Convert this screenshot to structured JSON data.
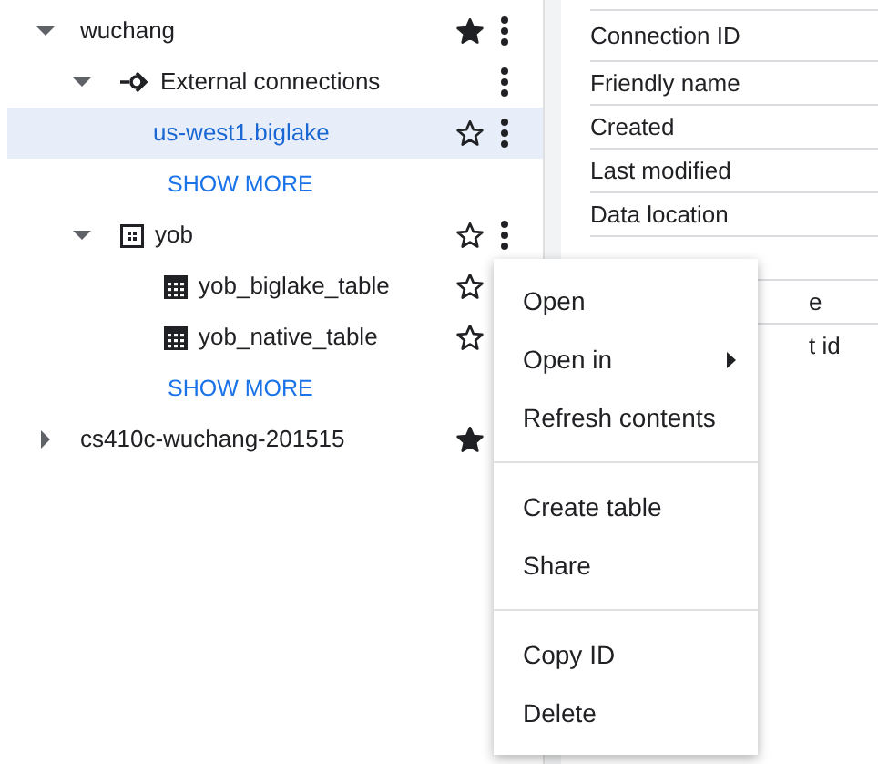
{
  "tree": [
    {
      "kind": "project",
      "label": "wuchang",
      "expanded": true,
      "starred": true,
      "selected": false,
      "children": [
        {
          "kind": "connections",
          "label": "External connections",
          "expanded": true,
          "selected": false,
          "children": [
            {
              "kind": "connection",
              "label": "us-west1.biglake",
              "starred": false,
              "selected": true
            },
            {
              "kind": "more",
              "label": "SHOW MORE"
            }
          ]
        },
        {
          "kind": "dataset",
          "label": "yob",
          "expanded": true,
          "starred": false,
          "selected": false,
          "children": [
            {
              "kind": "table",
              "label": "yob_biglake_table",
              "starred": false,
              "selected": false
            },
            {
              "kind": "table",
              "label": "yob_native_table",
              "starred": false,
              "selected": false
            },
            {
              "kind": "more",
              "label": "SHOW MORE"
            }
          ]
        }
      ]
    },
    {
      "kind": "project",
      "label": "cs410c-wuchang-201515",
      "expanded": false,
      "starred": true,
      "selected": false
    }
  ],
  "details": {
    "rows": [
      "Connection ID",
      "Friendly name",
      "Created",
      "Last modified",
      "Data location",
      "e",
      "t id"
    ]
  },
  "context_menu": {
    "groups": [
      [
        {
          "label": "Open",
          "submenu": false
        },
        {
          "label": "Open in",
          "submenu": true
        },
        {
          "label": "Refresh contents",
          "submenu": false
        }
      ],
      [
        {
          "label": "Create table",
          "submenu": false
        },
        {
          "label": "Share",
          "submenu": false
        }
      ],
      [
        {
          "label": "Copy ID",
          "submenu": false
        },
        {
          "label": "Delete",
          "submenu": false
        }
      ]
    ]
  }
}
